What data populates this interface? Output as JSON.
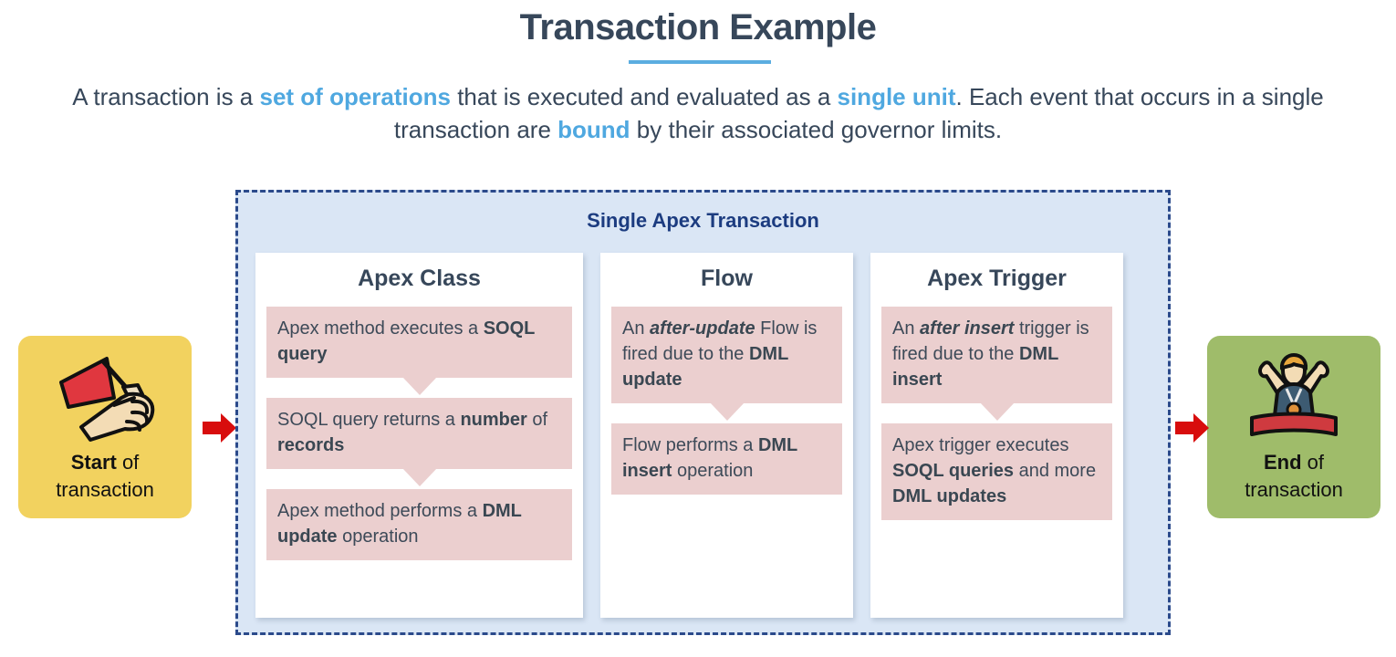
{
  "header": {
    "title": "Transaction Example",
    "underline_color": "#5bade0",
    "subtitle_parts": [
      {
        "text": "A transaction is a ",
        "accent": false
      },
      {
        "text": "set of operations",
        "accent": true
      },
      {
        "text": " that is executed and evaluated as a ",
        "accent": false
      },
      {
        "text": "single unit",
        "accent": true
      },
      {
        "text": ". Each event that occurs in a single transaction are ",
        "accent": false
      },
      {
        "text": "bound",
        "accent": true
      },
      {
        "text": " by their associated governor limits.",
        "accent": false
      }
    ]
  },
  "start_node": {
    "icon": "hand-holding-red-flag-icon",
    "label_bold": "Start",
    "label_rest": " of",
    "label_line2": "transaction",
    "background": "#f2d25f"
  },
  "end_node": {
    "icon": "person-crossing-finish-line-icon",
    "label_bold": "End",
    "label_rest": " of",
    "label_line2": "transaction",
    "background": "#9fbc6a"
  },
  "arrows": {
    "color": "#d80d0d",
    "count": 4,
    "names": [
      "arrow-start-to-apex-class",
      "arrow-apex-class-to-flow",
      "arrow-flow-to-apex-trigger",
      "arrow-apex-trigger-to-end"
    ]
  },
  "transaction": {
    "title": "Single Apex Transaction",
    "background": "#dae6f5",
    "border_color": "#2b4a8b",
    "columns": [
      {
        "name": "apex-class",
        "title": "Apex Class",
        "steps": [
          [
            {
              "text": "Apex method executes a ",
              "style": "normal"
            },
            {
              "text": "SOQL query",
              "style": "bold"
            }
          ],
          [
            {
              "text": "SOQL query returns a ",
              "style": "normal"
            },
            {
              "text": "number",
              "style": "bold"
            },
            {
              "text": " of ",
              "style": "normal"
            },
            {
              "text": "records",
              "style": "bold"
            }
          ],
          [
            {
              "text": "Apex method performs a ",
              "style": "normal"
            },
            {
              "text": "DML update",
              "style": "bold"
            },
            {
              "text": " operation",
              "style": "normal"
            }
          ]
        ]
      },
      {
        "name": "flow",
        "title": "Flow",
        "steps": [
          [
            {
              "text": "An ",
              "style": "normal"
            },
            {
              "text": "after-update",
              "style": "bold-italic"
            },
            {
              "text": " Flow is fired due to the ",
              "style": "normal"
            },
            {
              "text": "DML update",
              "style": "bold"
            }
          ],
          [
            {
              "text": "Flow performs a ",
              "style": "normal"
            },
            {
              "text": "DML insert",
              "style": "bold"
            },
            {
              "text": " operation",
              "style": "normal"
            }
          ]
        ]
      },
      {
        "name": "apex-trigger",
        "title": "Apex Trigger",
        "steps": [
          [
            {
              "text": "An ",
              "style": "normal"
            },
            {
              "text": "after insert",
              "style": "bold-italic"
            },
            {
              "text": " trigger is fired due to the ",
              "style": "normal"
            },
            {
              "text": "DML insert",
              "style": "bold"
            }
          ],
          [
            {
              "text": "Apex trigger executes ",
              "style": "normal"
            },
            {
              "text": "SOQL queries",
              "style": "bold"
            },
            {
              "text": " and more ",
              "style": "normal"
            },
            {
              "text": "DML updates",
              "style": "bold"
            }
          ]
        ]
      }
    ]
  }
}
